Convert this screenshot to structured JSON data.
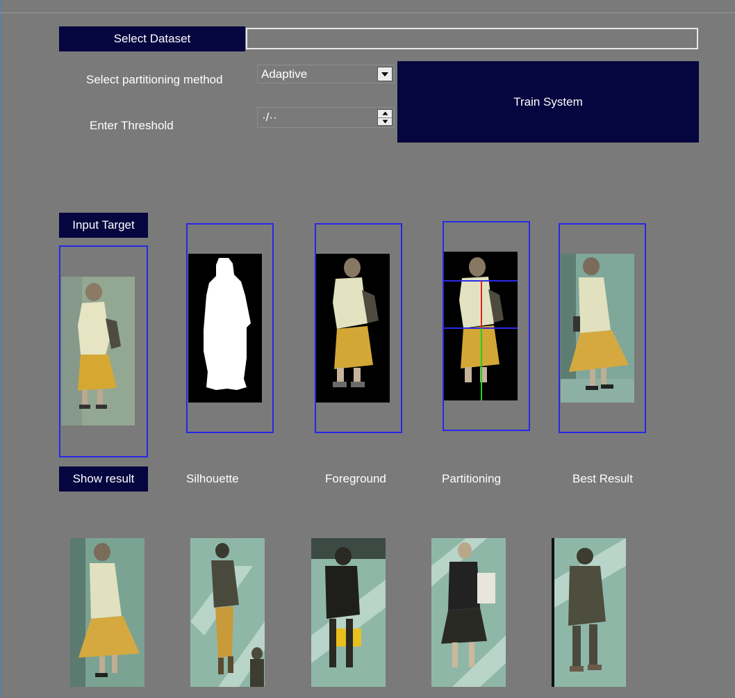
{
  "toolbar": {
    "select_dataset_label": "Select Dataset",
    "dataset_path_value": "",
    "partition_label": "Select partitioning method",
    "partition_value": "Adaptive",
    "threshold_label": "Enter Threshold",
    "threshold_value": "·/··",
    "train_label": "Train System"
  },
  "panel": {
    "input_target_label": "Input Target",
    "show_result_label": "Show result",
    "captions": {
      "silhouette": "Silhouette",
      "foreground": "Foreground",
      "partitioning": "Partitioning",
      "best_result": "Best Result"
    }
  },
  "colors": {
    "button_bg": "#05053f",
    "frame_border": "#2727e8",
    "window_bg": "#7a7a7a",
    "partition_horizontal": "#2a2ae8",
    "partition_upper_axis": "#e02020",
    "partition_lower_axis": "#20d020"
  },
  "icons": {
    "dropdown": "chevron-down-icon",
    "spinner_up": "arrow-up-icon",
    "spinner_down": "arrow-down-icon"
  }
}
